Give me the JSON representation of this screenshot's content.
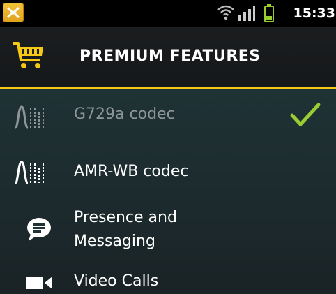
{
  "status_bar": {
    "time": "15:33",
    "icons": [
      "app-notification-icon",
      "wifi-icon",
      "signal-icon",
      "battery-icon"
    ]
  },
  "header": {
    "title": "PREMIUM FEATURES",
    "icon": "shopping-cart-icon",
    "accent_color": "#f5c815"
  },
  "features": [
    {
      "label": "G729a codec",
      "icon": "waveform-icon",
      "state": "purchased",
      "status_icon": "checkmark-icon"
    },
    {
      "label": "AMR-WB codec",
      "icon": "waveform-icon",
      "state": "available"
    },
    {
      "label": "Presence and Messaging",
      "line1": "Presence and",
      "line2": "Messaging",
      "icon": "chat-bubble-icon",
      "state": "available"
    },
    {
      "label": "Video Calls",
      "icon": "video-camera-icon",
      "state": "available"
    }
  ],
  "colors": {
    "check": "#9acd32",
    "disabled_text": "#8d9597",
    "accent": "#f5c815"
  }
}
